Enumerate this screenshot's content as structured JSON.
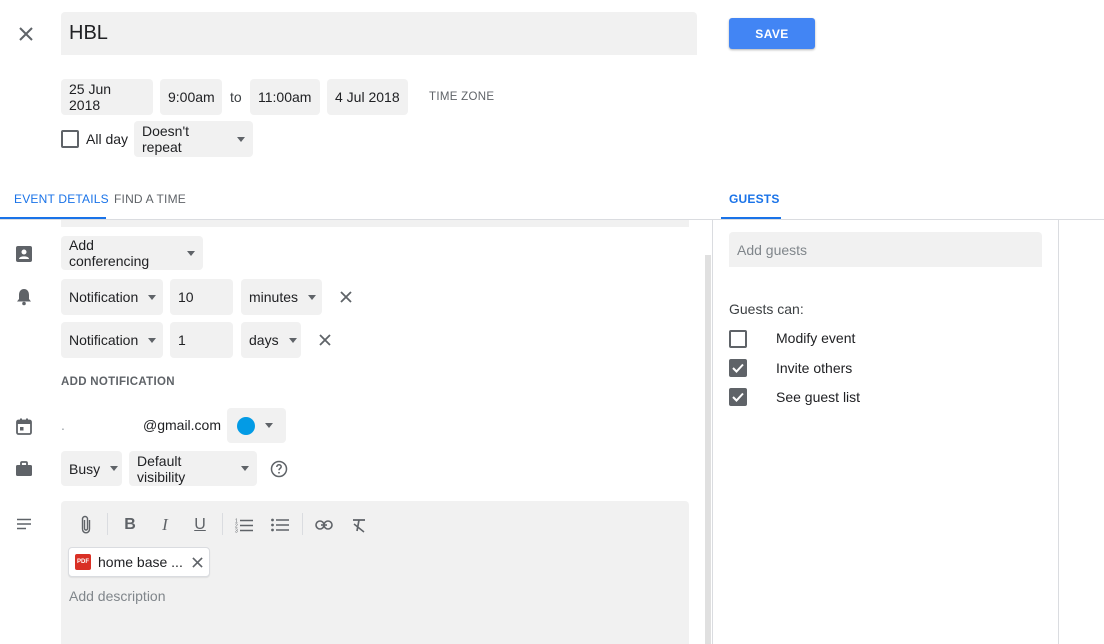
{
  "header": {
    "title_value": "HBL",
    "save_label": "SAVE"
  },
  "datetime": {
    "start_date": "25 Jun 2018",
    "start_time": "9:00am",
    "to_label": "to",
    "end_time": "11:00am",
    "end_date": "4 Jul 2018",
    "timezone_label": "TIME ZONE",
    "all_day_label": "All day",
    "repeat_value": "Doesn't repeat"
  },
  "tabs": {
    "event_details": "EVENT DETAILS",
    "find_a_time": "FIND A TIME",
    "guests": "GUESTS"
  },
  "details": {
    "conferencing_label": "Add conferencing",
    "notifications": [
      {
        "type": "Notification",
        "value": "10",
        "unit": "minutes"
      },
      {
        "type": "Notification",
        "value": "1",
        "unit": "days"
      }
    ],
    "add_notification_label": "ADD NOTIFICATION",
    "calendar_prefix": ".",
    "calendar_email": "@gmail.com",
    "calendar_color": "#039be5",
    "busy_value": "Busy",
    "visibility_value": "Default visibility",
    "attachment_name": "home base ...",
    "attachment_type": "PDF",
    "description_placeholder": "Add description"
  },
  "guests": {
    "add_placeholder": "Add guests",
    "guests_can_label": "Guests can:",
    "permissions": [
      {
        "label": "Modify event",
        "checked": false
      },
      {
        "label": "Invite others",
        "checked": true
      },
      {
        "label": "See guest list",
        "checked": true
      }
    ]
  },
  "colors": {
    "accent": "#4285f4",
    "active_tab": "#1a73e8",
    "field_bg": "#f1f1f1"
  }
}
